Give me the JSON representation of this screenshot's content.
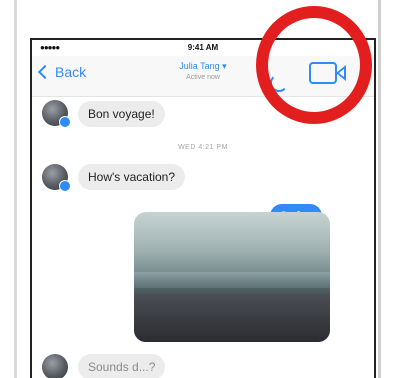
{
  "status_bar": {
    "signal": "●●●●● ",
    "time": "9:41 AM"
  },
  "nav": {
    "back_label": "Back",
    "contact_name": "Julia Tang ▾",
    "contact_status": "Active now"
  },
  "messages": [
    {
      "direction": "incoming",
      "text": "Bon voyage!"
    },
    {
      "direction": "incoming",
      "text": "How's vacation?"
    },
    {
      "direction": "outgoing",
      "text": "So fun"
    }
  ],
  "timestamp": "WED 4:21 PM",
  "partial_message": "Sounds d...?",
  "icons": {
    "back": "chevron-left-icon",
    "phone": "phone-icon",
    "video": "video-camera-icon",
    "badge": "messenger-badge-icon"
  },
  "colors": {
    "accent": "#2f8bf5",
    "highlight": "#e31e1e",
    "incoming_bubble": "#ececec"
  }
}
